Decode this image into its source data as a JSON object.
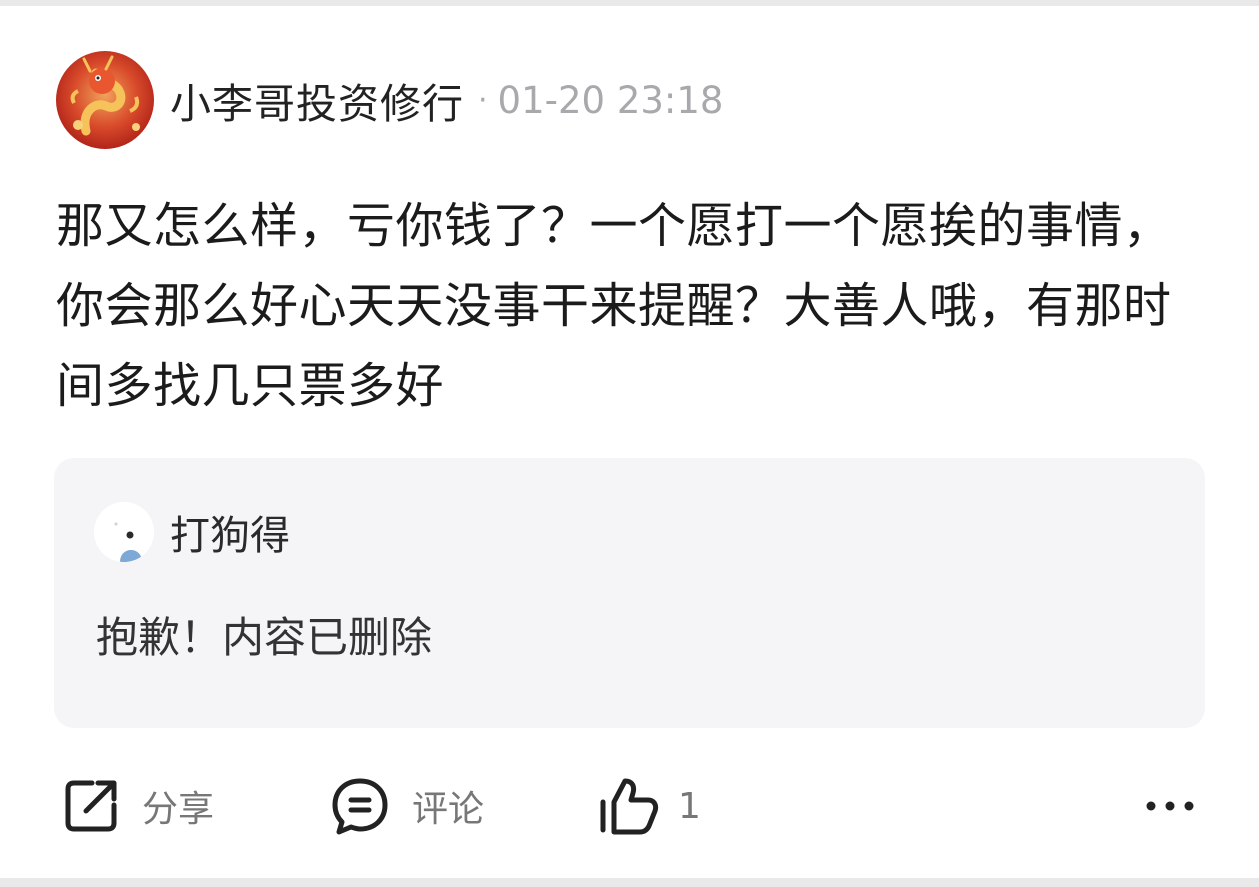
{
  "post": {
    "author": "小李哥投资修行",
    "separator": "·",
    "time": "01-20 23:18",
    "text": "那又怎么样，亏你钱了？一个愿打一个愿挨的事情，你会那么好心天天没事干来提醒？大善人哦，有那时间多找几只票多好"
  },
  "quoted": {
    "author": "打狗得",
    "text": "抱歉！内容已删除"
  },
  "actions": {
    "share_label": "分享",
    "comment_label": "评论",
    "like_count": "1"
  },
  "colors": {
    "text_primary": "#1b1b1b",
    "text_secondary": "#a9a9ad",
    "quote_bg": "#f5f5f8",
    "avatar_red": "#c8261c"
  },
  "icons": [
    "dragon-avatar-icon",
    "share-icon",
    "comment-icon",
    "like-icon",
    "more-icon"
  ]
}
